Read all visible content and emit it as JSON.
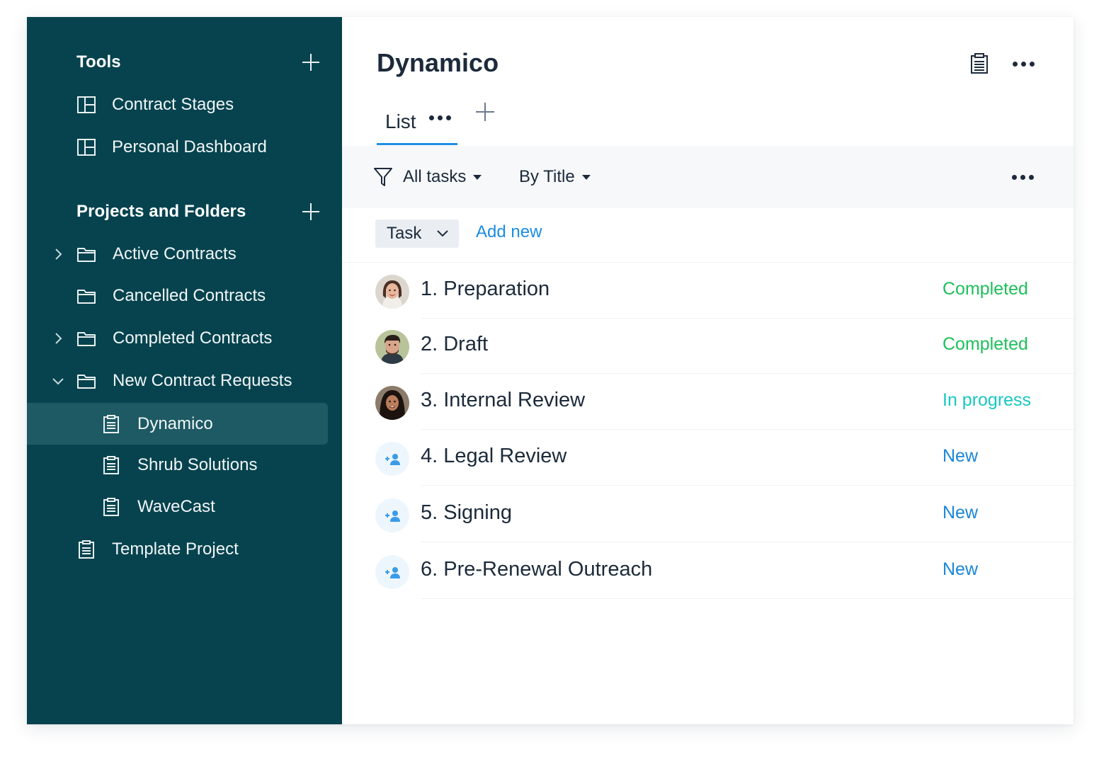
{
  "sidebar": {
    "tools_title": "Tools",
    "tools": [
      {
        "label": "Contract Stages"
      },
      {
        "label": "Personal Dashboard"
      }
    ],
    "projects_title": "Projects and Folders",
    "projects": [
      {
        "label": "Active Contracts"
      },
      {
        "label": "Cancelled Contracts"
      },
      {
        "label": "Completed Contracts"
      },
      {
        "label": "New Contract Requests"
      },
      {
        "label": "Dynamico"
      },
      {
        "label": "Shrub Solutions"
      },
      {
        "label": "WaveCast"
      },
      {
        "label": "Template Project"
      }
    ]
  },
  "header": {
    "title": "Dynamico",
    "tab_label": "List"
  },
  "toolbar": {
    "filter_label": "All tasks",
    "sort_label": "By Title"
  },
  "task_bar": {
    "type_label": "Task",
    "add_label": "Add new"
  },
  "tasks": [
    {
      "name": "1. Preparation",
      "status": "Completed"
    },
    {
      "name": "2. Draft",
      "status": "Completed"
    },
    {
      "name": "3. Internal Review",
      "status": "In progress"
    },
    {
      "name": "4. Legal Review",
      "status": "New"
    },
    {
      "name": "5. Signing",
      "status": "New"
    },
    {
      "name": "6. Pre-Renewal Outreach",
      "status": "New"
    }
  ],
  "colors": {
    "sidebar_bg": "#06434e",
    "sidebar_active": "#1d5a64",
    "accent": "#1e8ee6",
    "completed": "#1dc05a",
    "in_progress": "#18c7c2",
    "new": "#1a86d8"
  }
}
